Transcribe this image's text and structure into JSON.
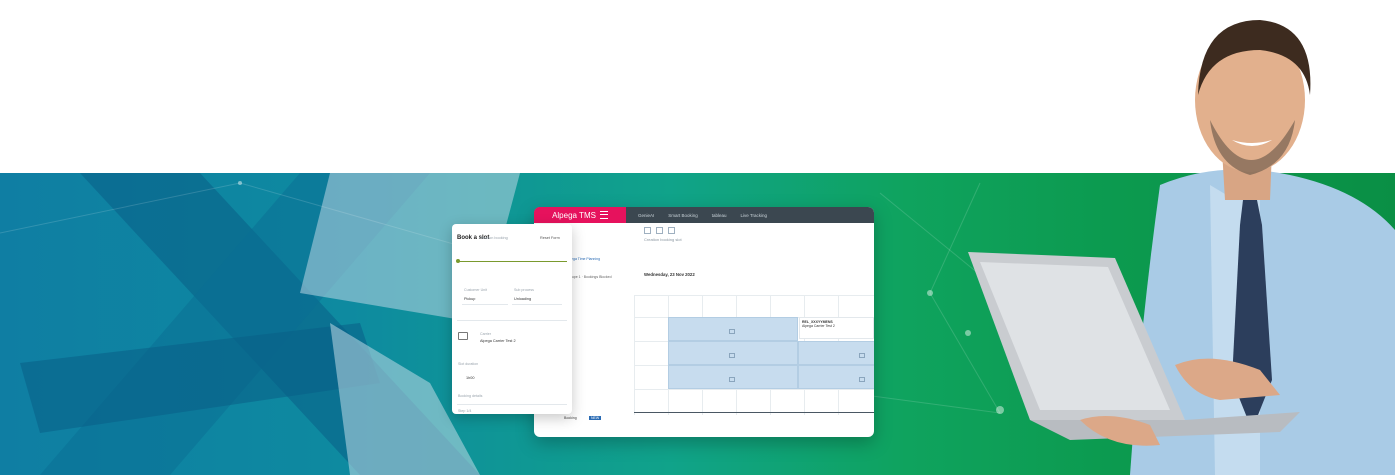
{
  "app": {
    "brand": "Alpega TMS",
    "nav": [
      "GenieAI",
      "Smart Booking",
      "tableau",
      "Live Tracking"
    ],
    "toolbar_label": "Creation booking slot",
    "date_heading": "Wednesday, 23 Nov 2022",
    "selected_slot_title": "REL_XXXYYMENS",
    "selected_slot_sub": "Alpega Carrier Test 2",
    "mid_link": "Alpega Time Planning",
    "mid_text": "Groupe 1 · Bookings Blocked",
    "bottom_label": "Booking",
    "bottom_badge": "NEW"
  },
  "book_slot": {
    "title": "Book a slot",
    "subtitle": "Creation booking",
    "reset_label": "Reset Form",
    "field1_label": "Customer Unit",
    "field1_value": "Pickup",
    "field2_label": "Sub process",
    "field2_value": "Unloading",
    "carrier_label": "Carrier",
    "carrier_value": "Alpega Carrier Test 2",
    "slot_label": "Slot duration",
    "slot_value": "1h00",
    "bottom_label": "Booking details",
    "footer_value": "Step 1/4"
  },
  "colors": {
    "brand_pink": "#e6125d",
    "banner_blue": "#0f7ea3",
    "banner_green": "#0a8f45",
    "slot_blue": "#c7dcee"
  }
}
